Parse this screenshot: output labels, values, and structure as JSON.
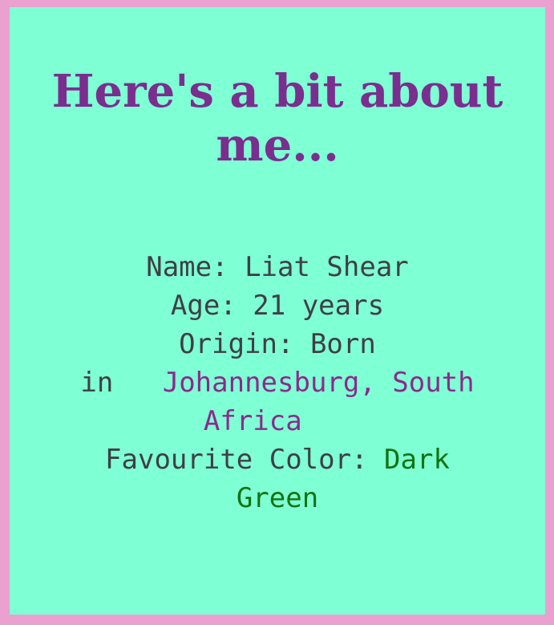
{
  "heading": {
    "line1": "Here's a bit about",
    "line2": "me..."
  },
  "bio": {
    "name_label": "Name:",
    "name_value": "Liat Shear",
    "age_label": "Age:",
    "age_value": "21 years",
    "origin_label": "Origin:",
    "origin_born": "Born",
    "origin_in": "in",
    "origin_place_line1": "Johannesburg, South",
    "origin_place_line2": "Africa",
    "color_label": "Favourite Color:",
    "color_value_line1": "Dark",
    "color_value_line2": "Green"
  },
  "colors": {
    "background_border": "#eba1cf",
    "card_background": "#7fffd4",
    "heading": "#7a2e8e",
    "body_text": "#3f3f44",
    "place_accent": "#8b2a8b",
    "favourite_color_accent": "#127412"
  }
}
